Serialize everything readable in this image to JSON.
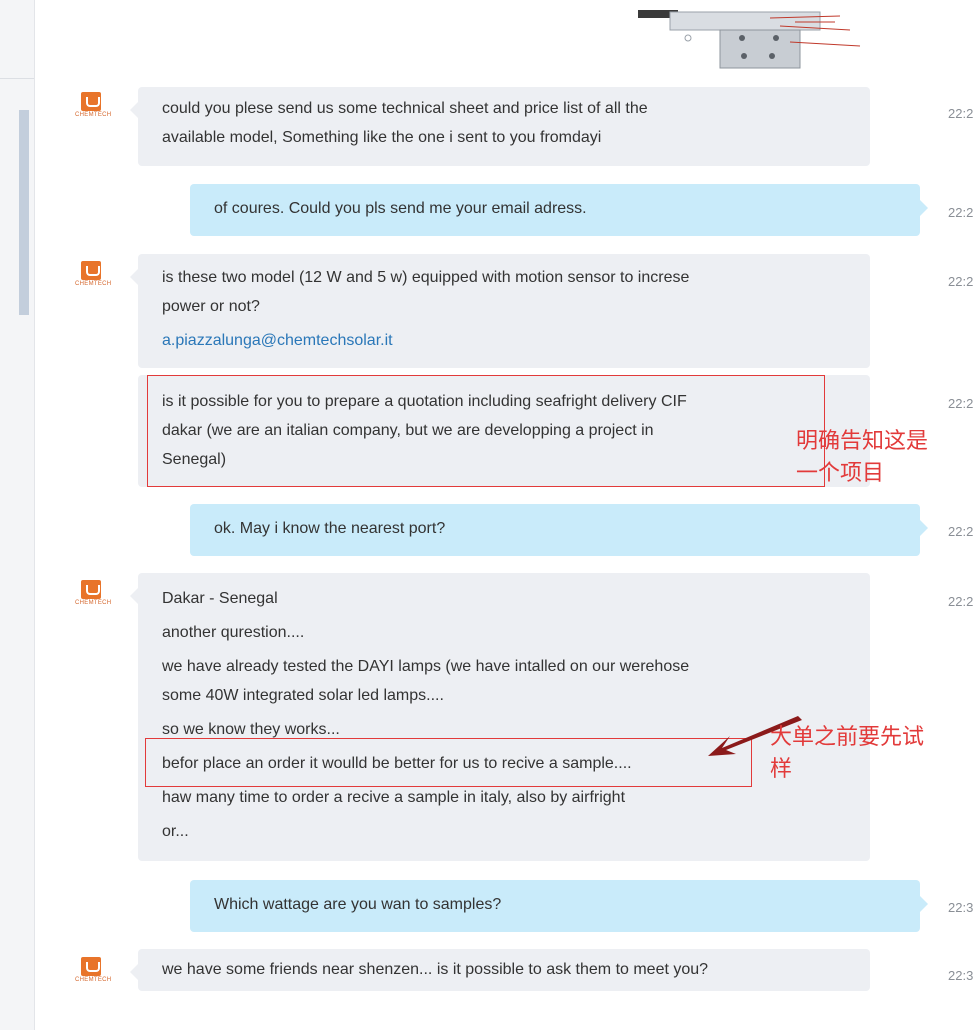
{
  "avatar": {
    "logo_text": "CHEMTECH"
  },
  "messages": [
    {
      "id": "m1",
      "direction": "in",
      "lines": [
        "could you plese send us some technical sheet and price list of all the",
        "available model, Something like the one i sent to you fromdayi"
      ],
      "time": "22:2"
    },
    {
      "id": "m2",
      "direction": "out",
      "lines": [
        "of coures. Could you pls send me your email adress."
      ],
      "time": "22:2"
    },
    {
      "id": "m3",
      "direction": "in",
      "lines": [
        "is these two model (12 W and 5 w) equipped with motion sensor to increse",
        "power or not?"
      ],
      "link": "a.piazzalunga@chemtechsolar.it",
      "time": "22:2"
    },
    {
      "id": "m4",
      "direction": "in",
      "lines": [
        "is it possible for you to prepare a quotation including seafright delivery CIF",
        "dakar (we are an italian company, but we are developping a project in",
        "Senegal)"
      ],
      "time": "22:2"
    },
    {
      "id": "m5",
      "direction": "out",
      "lines": [
        "ok. May i know the nearest port?"
      ],
      "time": "22:2"
    },
    {
      "id": "m6",
      "direction": "in",
      "paragraphs": [
        "Dakar - Senegal",
        "another qurestion....",
        "we have already tested the DAYI lamps (we have intalled on our werehose",
        "some 40W integrated solar led lamps....",
        "so we know they works...",
        "befor place an order it woulld be better for us to recive a sample....",
        "haw many time to order a recive a sample in italy, also by airfright",
        "or..."
      ],
      "time": "22:2"
    },
    {
      "id": "m7",
      "direction": "out",
      "lines": [
        "Which wattage are you wan to samples?"
      ],
      "time": "22:3"
    },
    {
      "id": "m8",
      "direction": "in",
      "lines": [
        "we have some friends near shenzen... is it possible to ask them to meet you?"
      ],
      "time": "22:3"
    }
  ],
  "annotations": {
    "note1_line1": "明确告知这是",
    "note1_line2": "一个项目",
    "note2_line1": "大单之前要先试",
    "note2_line2": "样"
  },
  "colors": {
    "annotation": "#e23a3a",
    "incoming_bubble": "#edeff3",
    "outgoing_bubble": "#c9ebfa",
    "link": "#2a77b8"
  }
}
